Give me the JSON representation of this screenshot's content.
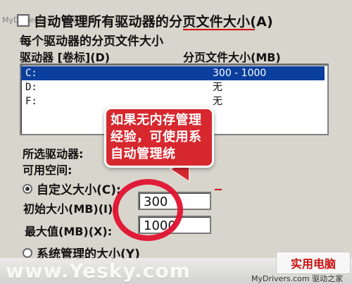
{
  "window": {
    "auto_manage_label": "自动管理所有驱动器的分页文件大小(A)",
    "group_title": "每个驱动器的分页文件大小",
    "watermark_small": "MyDrivers.com 驱动之家"
  },
  "drives_table": {
    "header_drive": "驱动器 [卷标](D)",
    "header_size": "分页文件大小(MB)",
    "rows": [
      {
        "drive": "C:",
        "size": "300 - 1000",
        "selected": true
      },
      {
        "drive": "D:",
        "size": "无",
        "selected": false
      },
      {
        "drive": "F:",
        "size": "无",
        "selected": false
      }
    ]
  },
  "selected_info": {
    "selected_drive_label": "所选驱动器:",
    "available_space_label": "可用空间:"
  },
  "options": {
    "custom_size_label": "自定义大小(C):",
    "initial_size_label": "初始大小(MB)(I):",
    "initial_size_value": "300",
    "max_size_label": "最大值(MB)(X):",
    "max_size_value": "1000",
    "system_managed_label": "系统管理的大小(Y)"
  },
  "callout": {
    "line1": "如果无内存管理",
    "line2": "经验，可使用系",
    "line3": "自动管理统"
  },
  "watermarks": {
    "site": "www.Yesky.com",
    "brand": "实用电脑",
    "mydrivers": "MyDrivers.com 驱动之家"
  }
}
